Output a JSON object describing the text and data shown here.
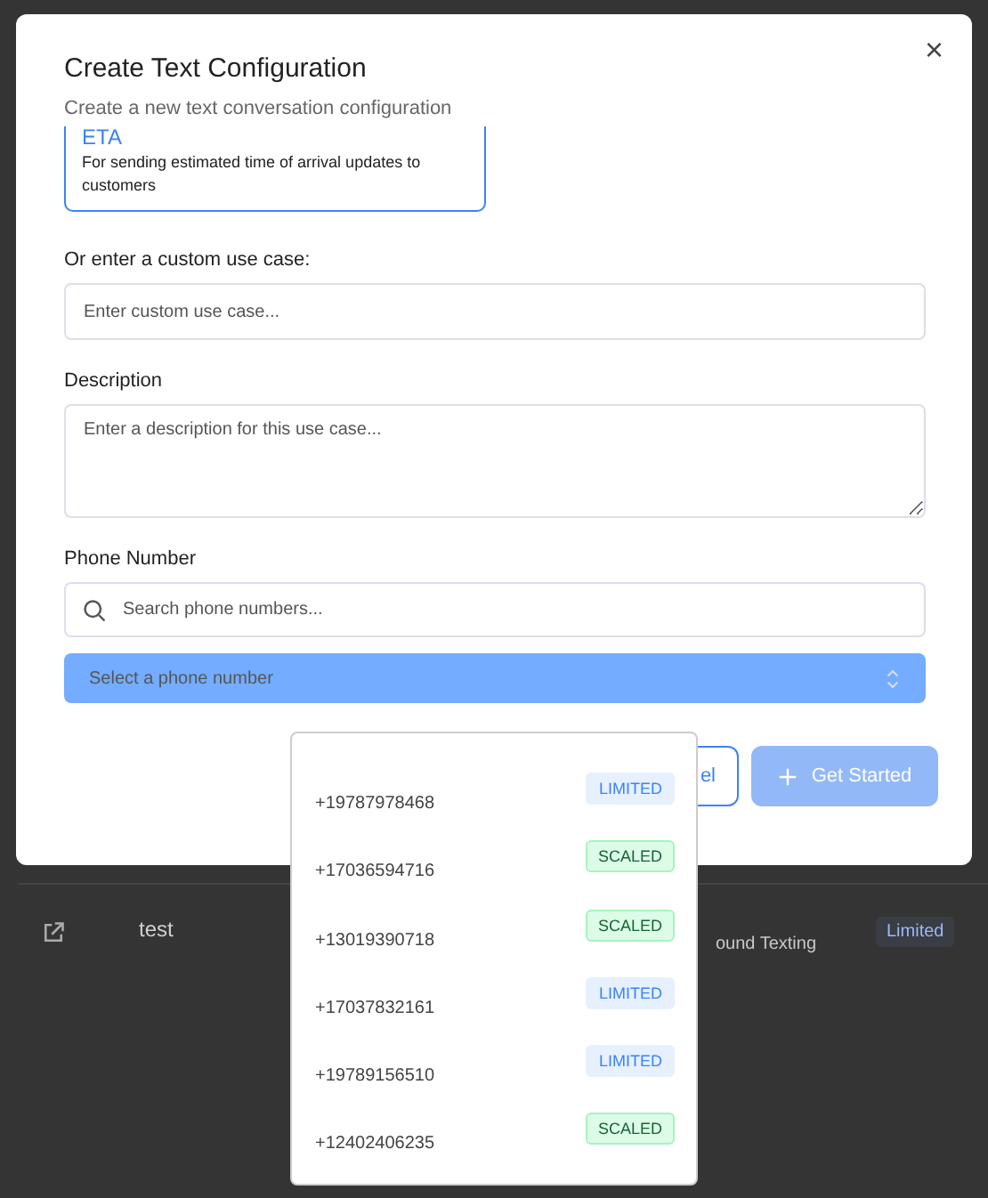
{
  "background_table": {
    "rows": [
      {
        "name": "test",
        "use_case": "ound Texting",
        "status": "Limited"
      }
    ]
  },
  "dialog": {
    "title": "Create Text Configuration",
    "subtitle": "Create a new text conversation configuration",
    "close_icon": "×",
    "use_case_card": {
      "title": "ETA",
      "description": "For sending estimated time of arrival updates to customers",
      "selected": true
    },
    "custom_use_case": {
      "label": "Or enter a custom use case:",
      "placeholder": "Enter custom use case..."
    },
    "description": {
      "label": "Description",
      "placeholder": "Enter a description for this use case..."
    },
    "phone_number": {
      "label": "Phone Number",
      "search_placeholder": "Search phone numbers...",
      "select_placeholder": "Select a phone number"
    },
    "buttons": {
      "cancel": "el",
      "submit": {
        "label": "Get Started",
        "disabled": true
      }
    }
  },
  "phone_dropdown": {
    "items": [
      {
        "number": "+19787978468",
        "tier": "LIMITED",
        "kind": "limited"
      },
      {
        "number": "+17036594716",
        "tier": "SCALED",
        "kind": "scaled"
      },
      {
        "number": "+13019390718",
        "tier": "SCALED",
        "kind": "scaled"
      },
      {
        "number": "+17037832161",
        "tier": "LIMITED",
        "kind": "limited"
      },
      {
        "number": "+19789156510",
        "tier": "LIMITED",
        "kind": "limited"
      },
      {
        "number": "+12402406235",
        "tier": "SCALED",
        "kind": "scaled"
      }
    ]
  }
}
